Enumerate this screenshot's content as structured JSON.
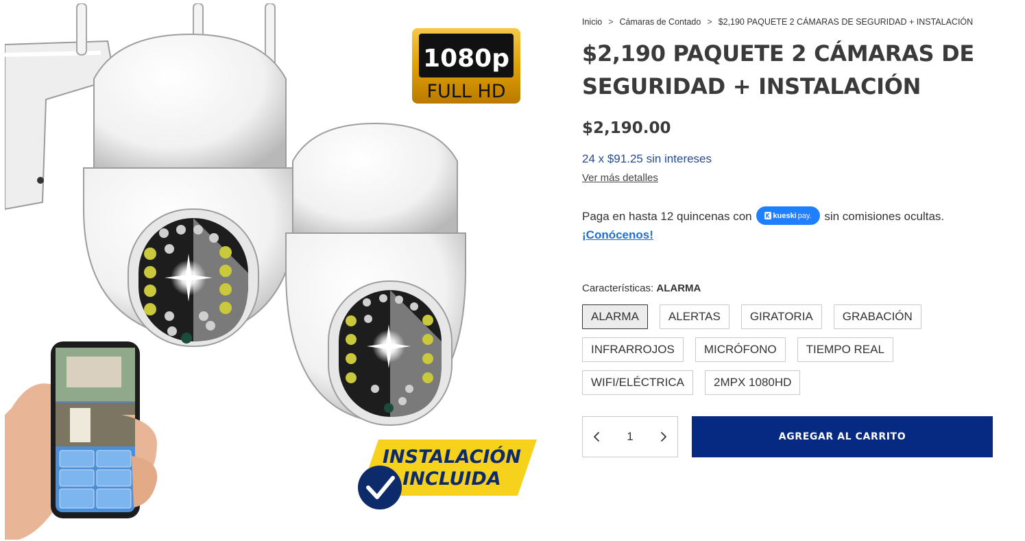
{
  "breadcrumb": {
    "home": "Inicio",
    "category": "Cámaras de Contado",
    "current": "$2,190 PAQUETE 2 CÁMARAS DE SEGURIDAD + INSTALACIÓN",
    "separator": ">"
  },
  "product": {
    "title": "$2,190 PAQUETE 2 CÁMARAS DE SEGURIDAD + INSTALACIÓN",
    "price": "$2,190.00",
    "installments": "24 x $91.25 sin intereses",
    "details_link": "Ver más detalles",
    "image": {
      "badge_top": "1080p",
      "badge_bottom": "FULL HD",
      "banner_line1": "INSTALACIÓN",
      "banner_line2": "INCLUIDA"
    }
  },
  "kueski": {
    "prefix": "Paga en hasta 12 quincenas con",
    "badge_bold": "kueski",
    "badge_light": "pay.",
    "suffix": "sin comisiones ocultas.",
    "cta": "¡Conócenos!"
  },
  "features": {
    "label": "Características:",
    "selected": "ALARMA",
    "options": [
      "ALARMA",
      "ALERTAS",
      "GIRATORIA",
      "GRABACIÓN",
      "INFRARROJOS",
      "MICRÓFONO",
      "TIEMPO REAL",
      "WIFI/ELÉCTRICA",
      "2MPX 1080HD"
    ]
  },
  "cart": {
    "quantity": "1",
    "add_button": "AGREGAR AL CARRITO"
  },
  "colors": {
    "primary_button": "#062a82",
    "installments_text": "#264a8d",
    "kueski_blue": "#1f7fff",
    "badge_gold": "#e0a400",
    "banner_yellow": "#f7d21c",
    "banner_navy": "#0d2a6b"
  },
  "icons": {
    "minus": "chevron-left-icon",
    "plus": "chevron-right-icon",
    "kueski": "kueski-logo-icon",
    "check": "check-circle-icon"
  }
}
